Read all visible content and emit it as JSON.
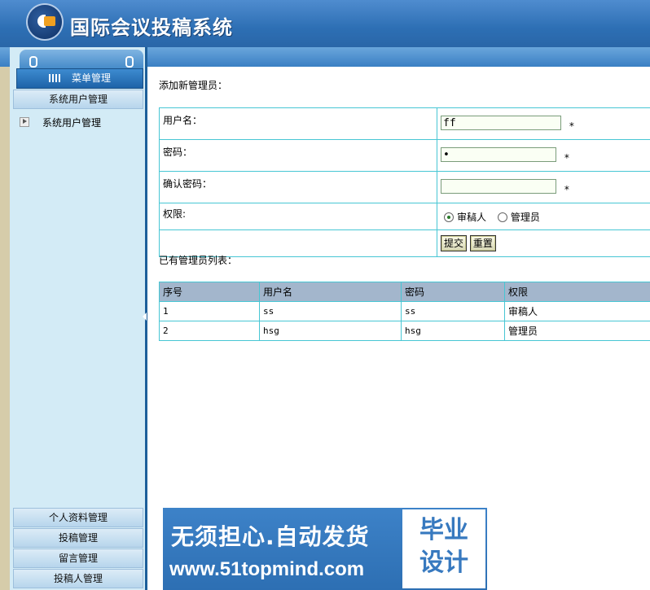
{
  "header": {
    "title": "国际会议投稿系统"
  },
  "sidebar": {
    "menu_title": "菜单管理",
    "section_title": "系统用户管理",
    "sub_item": "系统用户管理",
    "bottom_items": [
      "个人资料管理",
      "投稿管理",
      "留言管理",
      "投稿人管理"
    ]
  },
  "form": {
    "heading": "添加新管理员：",
    "username_label": "用户名：",
    "username_value": "ff",
    "password_label": "密码：",
    "password_value": "•",
    "confirm_label": "确认密码：",
    "confirm_value": "",
    "role_label": "权限:",
    "role_options": [
      "审稿人",
      "管理员"
    ],
    "role_selected": "审稿人",
    "required_mark": "*",
    "submit_label": "提交",
    "reset_label": "重置"
  },
  "admin_list": {
    "heading": "已有管理员列表：",
    "columns": [
      "序号",
      "用户名",
      "密码",
      "权限"
    ],
    "rows": [
      [
        "1",
        "ss",
        "ss",
        "审稿人"
      ],
      [
        "2",
        "hsg",
        "hsg",
        "管理员"
      ]
    ]
  },
  "watermark": {
    "line1": "无须担心.自动发货",
    "line2": "www.51topmind.com",
    "box_line1": "毕业",
    "box_line2": "设计"
  }
}
